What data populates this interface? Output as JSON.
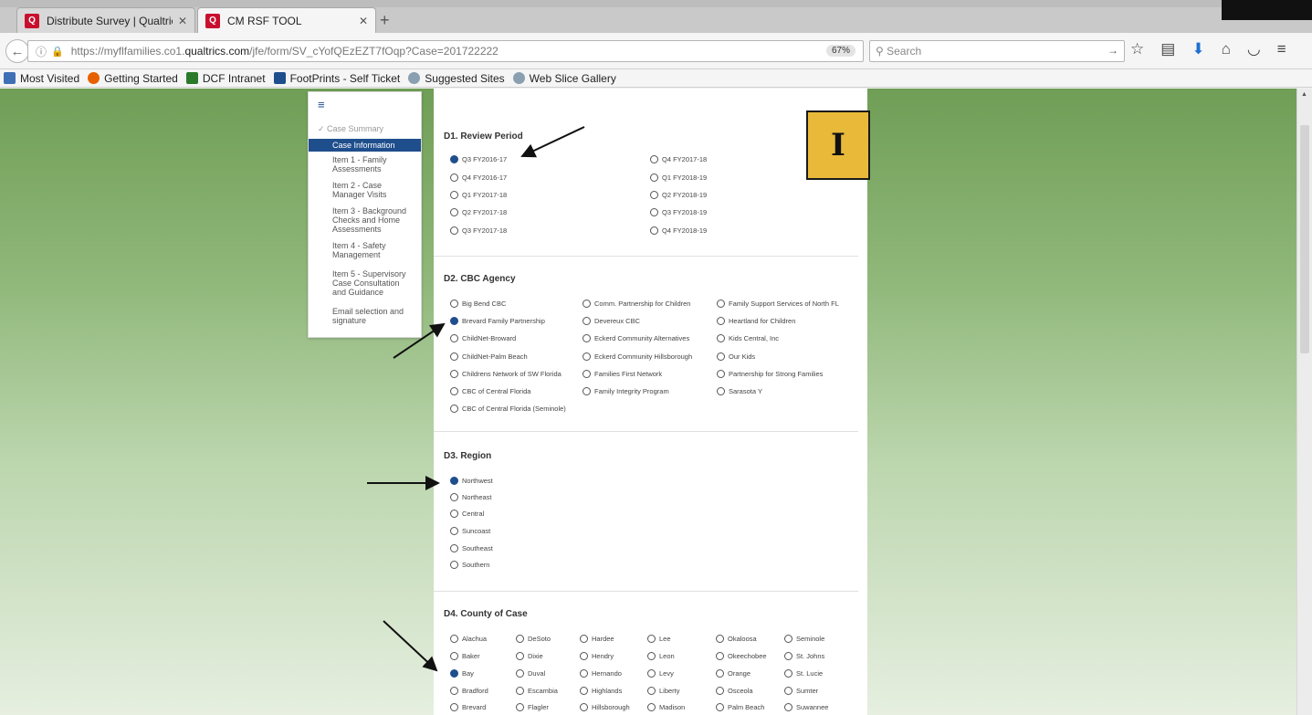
{
  "browser": {
    "tabs": [
      {
        "title": "Distribute Survey | Qualtric...",
        "active": false
      },
      {
        "title": "CM RSF TOOL",
        "active": true
      }
    ],
    "url_prefix": "https://myflfamilies.co1.",
    "url_domain": "qualtrics.com",
    "url_suffix": "/jfe/form/SV_cYofQEzEZT7fOqp?Case=201722222",
    "zoom": "67%",
    "search_placeholder": "Search",
    "bookmarks": [
      "Most Visited",
      "Getting Started",
      "DCF Intranet",
      "FootPrints - Self Ticket",
      "Suggested Sites",
      "Web Slice Gallery"
    ]
  },
  "sidebar": {
    "items": [
      {
        "label": "✓ Case Summary",
        "state": "done"
      },
      {
        "label": "Case Information",
        "state": "active"
      },
      {
        "label": "Item 1 - Family Assessments",
        "state": "normal"
      },
      {
        "label": "Item 2 - Case Manager Visits",
        "state": "normal"
      },
      {
        "label": "Item 3 - Background Checks and Home Assessments",
        "state": "normal"
      },
      {
        "label": "Item 4 - Safety Management",
        "state": "normal"
      },
      {
        "label": "Item 5 - Supervisory Case Consultation and Guidance",
        "state": "normal"
      },
      {
        "label": "Email selection and signature",
        "state": "normal"
      }
    ]
  },
  "badge": "I",
  "form": {
    "d1": {
      "title": "D1. Review Period",
      "options": [
        "Q3 FY2016-17",
        "Q4 FY2016-17",
        "Q1 FY2017-18",
        "Q2 FY2017-18",
        "Q3 FY2017-18",
        "Q4 FY2017-18",
        "Q1 FY2018-19",
        "Q2 FY2018-19",
        "Q3 FY2018-19",
        "Q4 FY2018-19"
      ],
      "selected": "Q3 FY2016-17"
    },
    "d2": {
      "title": "D2. CBC Agency",
      "options": [
        "Big Bend CBC",
        "Brevard Family Partnership",
        "ChildNet-Broward",
        "ChildNet-Palm Beach",
        "Childrens Network of SW Florida",
        "CBC of Central Florida",
        "CBC of Central Florida (Seminole)",
        "Comm. Partnership for Children",
        "Devereux CBC",
        "Eckerd Community Alternatives",
        "Eckerd Community Hillsborough",
        "Families First Network",
        "Family Integrity Program",
        "Family Support Services of North FL",
        "Heartland for Children",
        "Kids Central, Inc",
        "Our Kids",
        "Partnership for Strong Families",
        "Sarasota Y"
      ],
      "selected": "Brevard Family Partnership"
    },
    "d3": {
      "title": "D3. Region",
      "options": [
        "Northwest",
        "Northeast",
        "Central",
        "Suncoast",
        "Southeast",
        "Southern"
      ],
      "selected": "Northwest"
    },
    "d4": {
      "title": "D4. County of Case",
      "options": [
        "Alachua",
        "Baker",
        "Bay",
        "Bradford",
        "Brevard",
        "DeSoto",
        "Dixie",
        "Duval",
        "Escambia",
        "Flagler",
        "Hardee",
        "Hendry",
        "Hernando",
        "Highlands",
        "Hillsborough",
        "Lee",
        "Leon",
        "Levy",
        "Liberty",
        "Madison",
        "Okaloosa",
        "Okeechobee",
        "Orange",
        "Osceola",
        "Palm Beach",
        "Seminole",
        "St. Johns",
        "St. Lucie",
        "Sumter",
        "Suwannee"
      ],
      "selected": "Bay"
    }
  }
}
